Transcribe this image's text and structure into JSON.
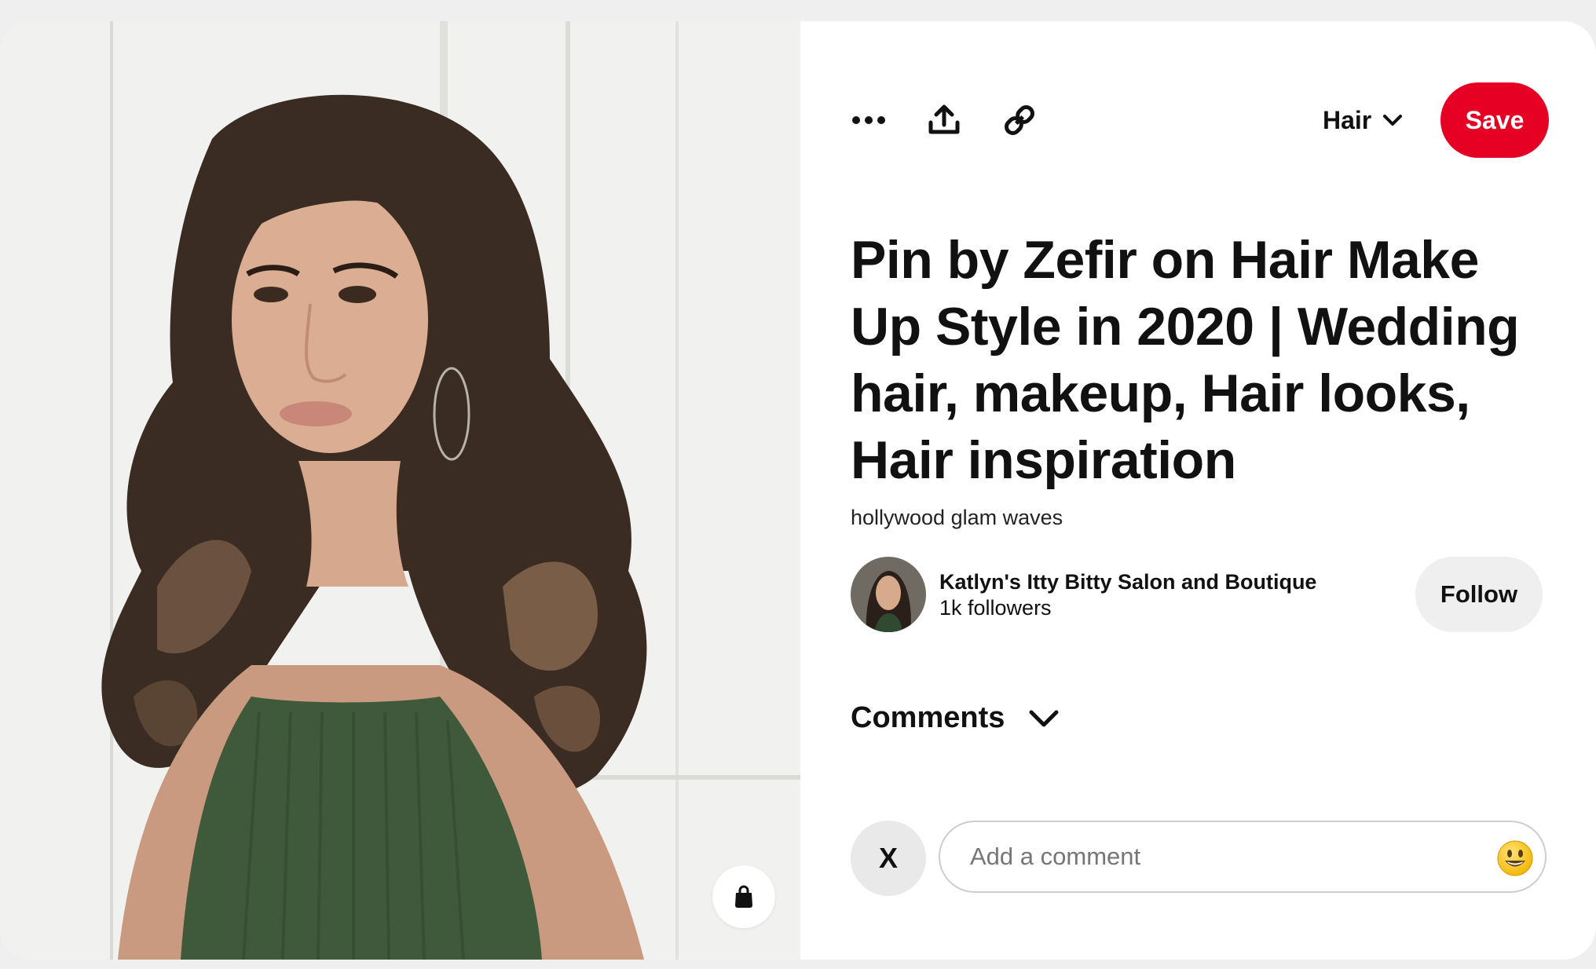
{
  "toolbar": {
    "more_icon": "ellipsis-icon",
    "share_icon": "share-upload-icon",
    "link_icon": "link-icon",
    "board_label": "Hair",
    "board_icon": "chevron-down-icon",
    "save_label": "Save"
  },
  "pin": {
    "title": "Pin by Zefir on Hair Make Up Style in 2020 | Wedding hair, makeup, Hair looks, Hair inspiration",
    "description": "hollywood glam waves",
    "shop_icon": "shopping-bag-icon"
  },
  "creator": {
    "name": "Katlyn's Itty Bitty Salon and Boutique",
    "followers": "1k followers",
    "follow_label": "Follow"
  },
  "comments": {
    "label": "Comments",
    "user_initial": "X",
    "placeholder": "Add a comment",
    "emoji_icon": "smiley-emoji-icon"
  },
  "colors": {
    "save_red": "#e60023",
    "follow_bg": "#efefef",
    "page_bg": "#efefef"
  }
}
